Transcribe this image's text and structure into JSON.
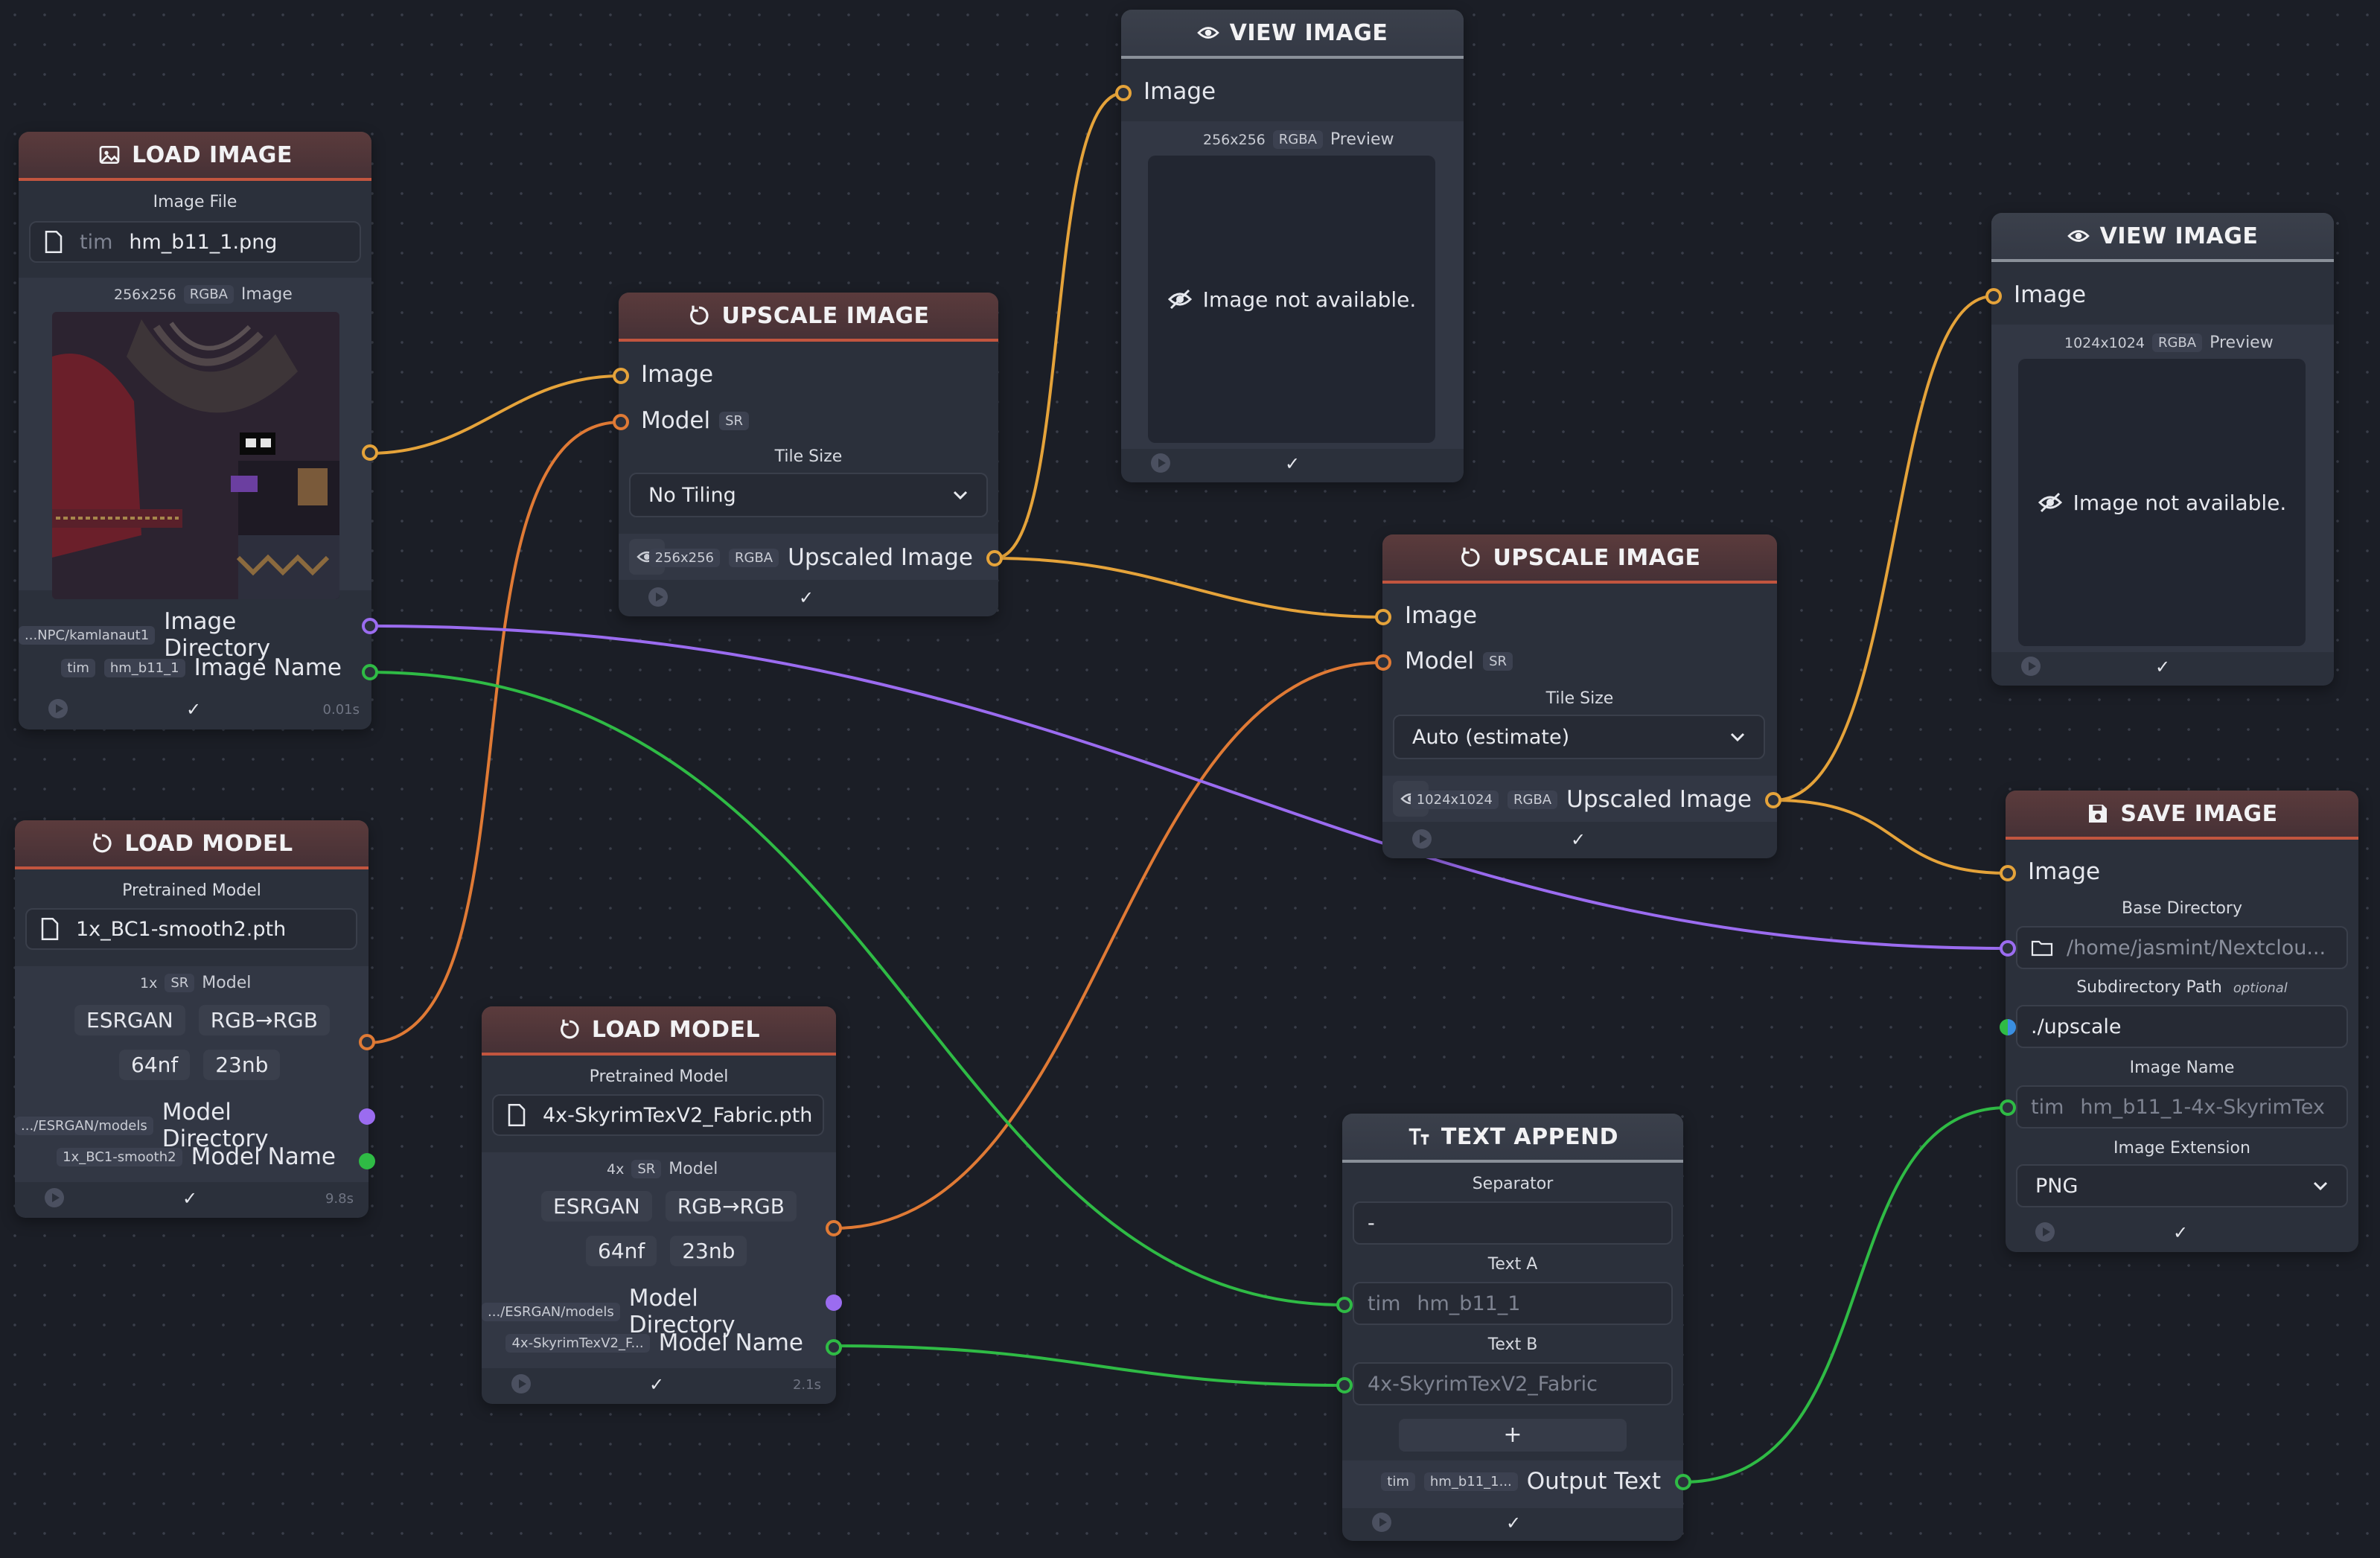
{
  "colors": {
    "image_wire": "#e5a33a",
    "model_wire": "#e07a35",
    "dir_wire": "#9b6cf0",
    "text_wire": "#2fbb45",
    "header_accent": "#c2553f",
    "background": "#1b1e26"
  },
  "load_image": {
    "title": "LOAD IMAGE",
    "file_label": "Image File",
    "file_prefix": "tim",
    "file_name": "hm_b11_1.png",
    "meta_size": "256x256",
    "meta_mode": "RGBA",
    "meta_label": "Image",
    "dir_chip": "...NPC/kamlanaut1",
    "dir_label": "Image Directory",
    "name_chip1": "tim",
    "name_chip2": "hm_b11_1",
    "name_label": "Image Name",
    "timing": "0.01s"
  },
  "load_model_1": {
    "title": "LOAD MODEL",
    "pretrained_label": "Pretrained Model",
    "file_name": "1x_BC1-smooth2.pth",
    "meta_scale": "1x",
    "meta_sr": "SR",
    "meta_label": "Model",
    "arch": "ESRGAN",
    "color": "RGB→RGB",
    "nf": "64nf",
    "nb": "23nb",
    "dir_chip": ".../ESRGAN/models",
    "dir_label": "Model Directory",
    "name_chip": "1x_BC1-smooth2",
    "name_label": "Model Name",
    "timing": "9.8s"
  },
  "load_model_2": {
    "title": "LOAD MODEL",
    "pretrained_label": "Pretrained Model",
    "file_name": "4x-SkyrimTexV2_Fabric.pth",
    "meta_scale": "4x",
    "meta_sr": "SR",
    "meta_label": "Model",
    "arch": "ESRGAN",
    "color": "RGB→RGB",
    "nf": "64nf",
    "nb": "23nb",
    "dir_chip": ".../ESRGAN/models",
    "dir_label": "Model Directory",
    "name_chip": "4x-SkyrimTexV2_F...",
    "name_label": "Model Name",
    "timing": "2.1s"
  },
  "upscale_1": {
    "title": "UPSCALE IMAGE",
    "in_image": "Image",
    "in_model": "Model",
    "sr": "SR",
    "tile_label": "Tile Size",
    "tile_value": "No Tiling",
    "out_size": "256x256",
    "out_mode": "RGBA",
    "out_label": "Upscaled Image"
  },
  "upscale_2": {
    "title": "UPSCALE IMAGE",
    "in_image": "Image",
    "in_model": "Model",
    "sr": "SR",
    "tile_label": "Tile Size",
    "tile_value": "Auto (estimate)",
    "out_size": "1024x1024",
    "out_mode": "RGBA",
    "out_label": "Upscaled Image"
  },
  "view_1": {
    "title": "VIEW IMAGE",
    "in_image": "Image",
    "meta_size": "256x256",
    "meta_mode": "RGBA",
    "meta_label": "Preview",
    "empty": "Image not available."
  },
  "view_2": {
    "title": "VIEW IMAGE",
    "in_image": "Image",
    "meta_size": "1024x1024",
    "meta_mode": "RGBA",
    "meta_label": "Preview",
    "empty": "Image not available."
  },
  "save_image": {
    "title": "SAVE IMAGE",
    "in_image": "Image",
    "base_dir_label": "Base Directory",
    "base_dir_value": "/home/jasmint/Nextclou...",
    "subdir_label": "Subdirectory Path",
    "subdir_optional": "optional",
    "subdir_value": "./upscale",
    "name_label": "Image Name",
    "name_prefix": "tim",
    "name_value": "hm_b11_1-4x-SkyrimTex",
    "ext_label": "Image Extension",
    "ext_value": "PNG"
  },
  "text_append": {
    "title": "TEXT APPEND",
    "sep_label": "Separator",
    "sep_value": "-",
    "a_label": "Text A",
    "a_prefix": "tim",
    "a_value": "hm_b11_1",
    "b_label": "Text B",
    "b_value": "4x-SkyrimTexV2_Fabric",
    "add": "+",
    "out_chip1": "tim",
    "out_chip2": "hm_b11_1...",
    "out_label": "Output Text"
  },
  "footer": {
    "check": "✓"
  }
}
